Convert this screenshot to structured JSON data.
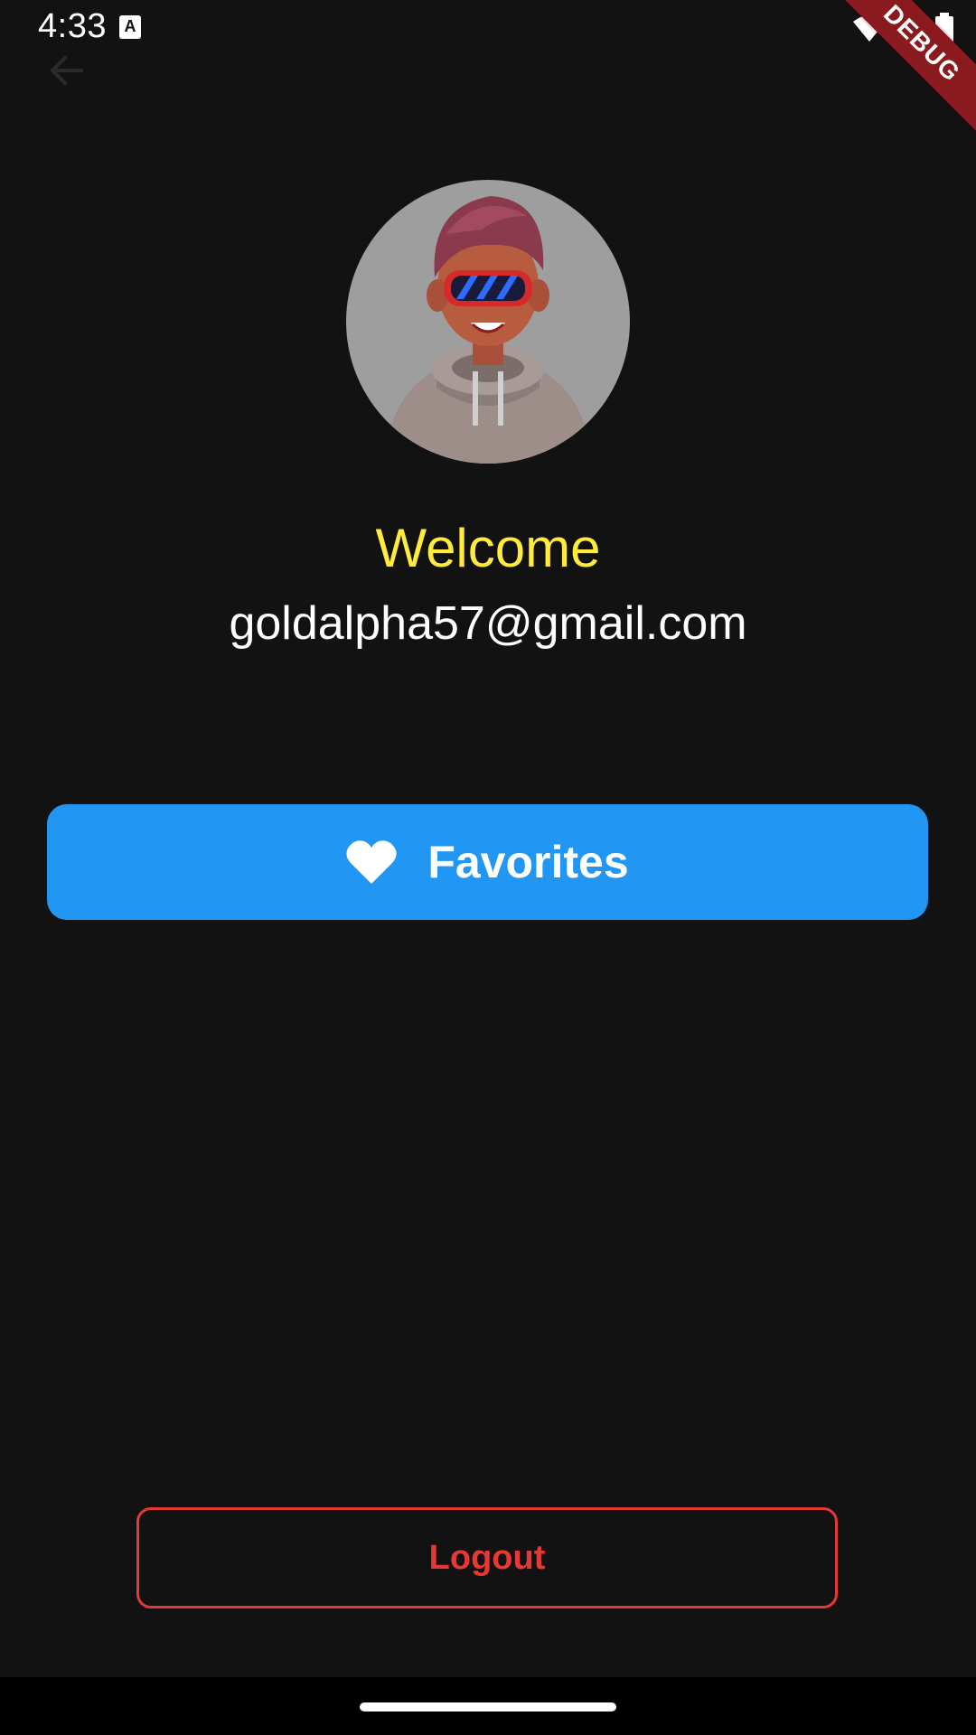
{
  "status_bar": {
    "time": "4:33",
    "notification_letter": "A",
    "icons": [
      "wifi-icon",
      "cellular-signal-icon",
      "battery-icon"
    ]
  },
  "debug_banner": {
    "label": "DEBUG",
    "color": "#8b1a1f"
  },
  "app_bar": {
    "back_icon": "arrow-back-icon"
  },
  "profile": {
    "avatar_icon": "avatar-3d-character",
    "welcome_text": "Welcome",
    "email": "goldalpha57@gmail.com"
  },
  "actions": {
    "favorites_label": "Favorites",
    "favorites_icon": "heart-icon",
    "logout_label": "Logout"
  },
  "colors": {
    "background": "#121212",
    "welcome": "#ffeb3b",
    "primary_button": "#2196f3",
    "logout": "#e53935"
  }
}
